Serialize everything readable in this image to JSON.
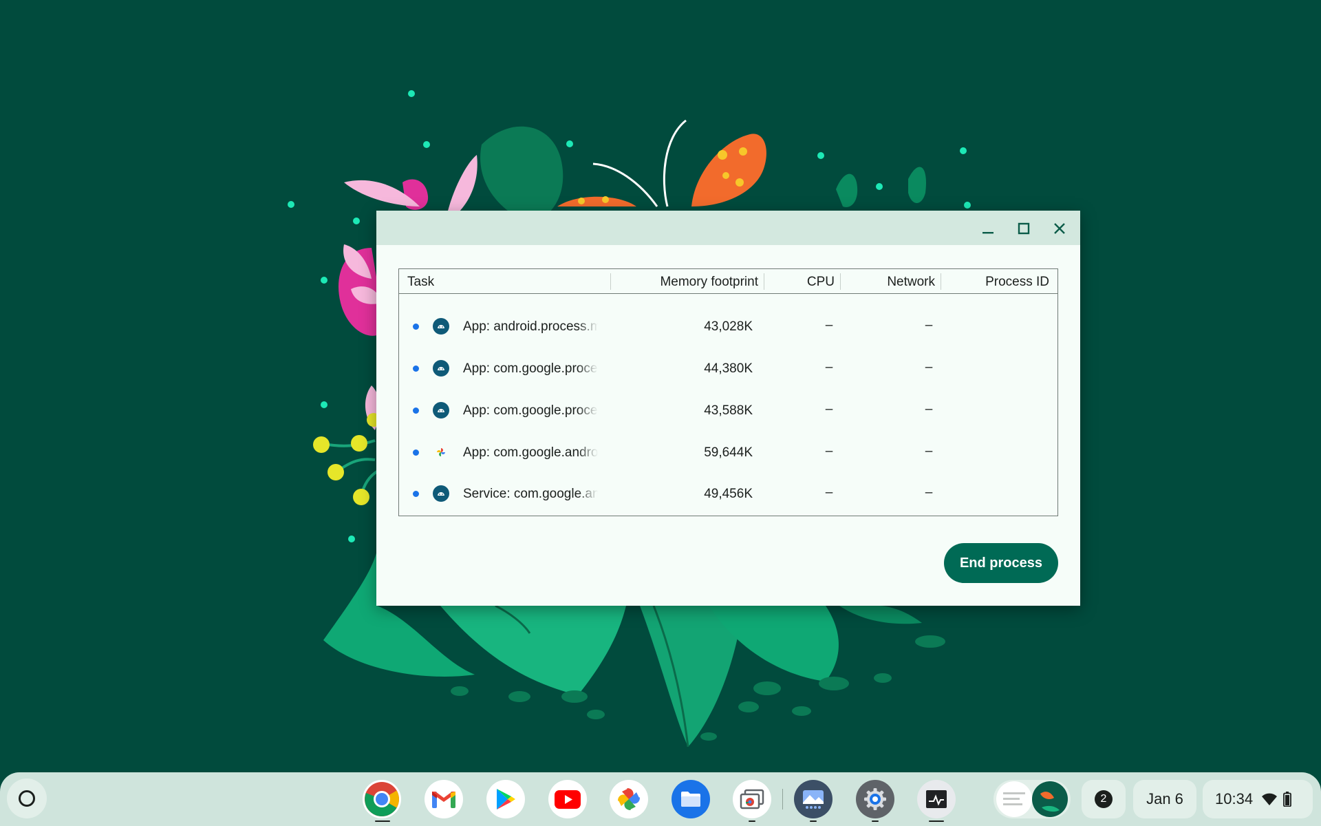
{
  "window": {
    "title_buttons": [
      "minimize",
      "maximize",
      "close"
    ],
    "columns": {
      "task": "Task",
      "memory": "Memory footprint",
      "cpu": "CPU",
      "network": "Network",
      "process_id": "Process ID"
    },
    "rows": [
      {
        "icon": "android-icon",
        "task": "App: android.process.media",
        "memory": "43,028K",
        "cpu": "–",
        "network": "–",
        "process_id": ""
      },
      {
        "icon": "android-icon",
        "task": "App: com.google.process.gapps",
        "memory": "44,380K",
        "cpu": "–",
        "network": "–",
        "process_id": ""
      },
      {
        "icon": "android-icon",
        "task": "App: com.google.process.gservices",
        "memory": "43,588K",
        "cpu": "–",
        "network": "–",
        "process_id": ""
      },
      {
        "icon": "google-photos-icon",
        "task": "App: com.google.android.apps.photos",
        "memory": "59,644K",
        "cpu": "–",
        "network": "–",
        "process_id": ""
      },
      {
        "icon": "android-icon",
        "task": "Service: com.google.android.gms",
        "memory": "49,456K",
        "cpu": "–",
        "network": "–",
        "process_id": ""
      }
    ],
    "end_process_label": "End process"
  },
  "shelf": {
    "apps": [
      {
        "name": "chrome-icon",
        "running": true
      },
      {
        "name": "gmail-icon",
        "running": false
      },
      {
        "name": "play-store-icon",
        "running": false
      },
      {
        "name": "youtube-icon",
        "running": false
      },
      {
        "name": "google-photos-icon",
        "running": false
      },
      {
        "name": "files-icon",
        "running": false
      },
      {
        "name": "screen-share-icon",
        "running": true
      },
      {
        "name": "gallery-icon",
        "running": true
      },
      {
        "name": "settings-icon",
        "running": true
      },
      {
        "name": "task-manager-icon",
        "running": true
      }
    ],
    "notification_count": "2",
    "date": "Jan 6",
    "time": "10:34"
  },
  "colors": {
    "desktop": "#014b3d",
    "accent": "#006a55",
    "titlebar": "#d3e8df",
    "shelf": "#cfe4dc"
  }
}
